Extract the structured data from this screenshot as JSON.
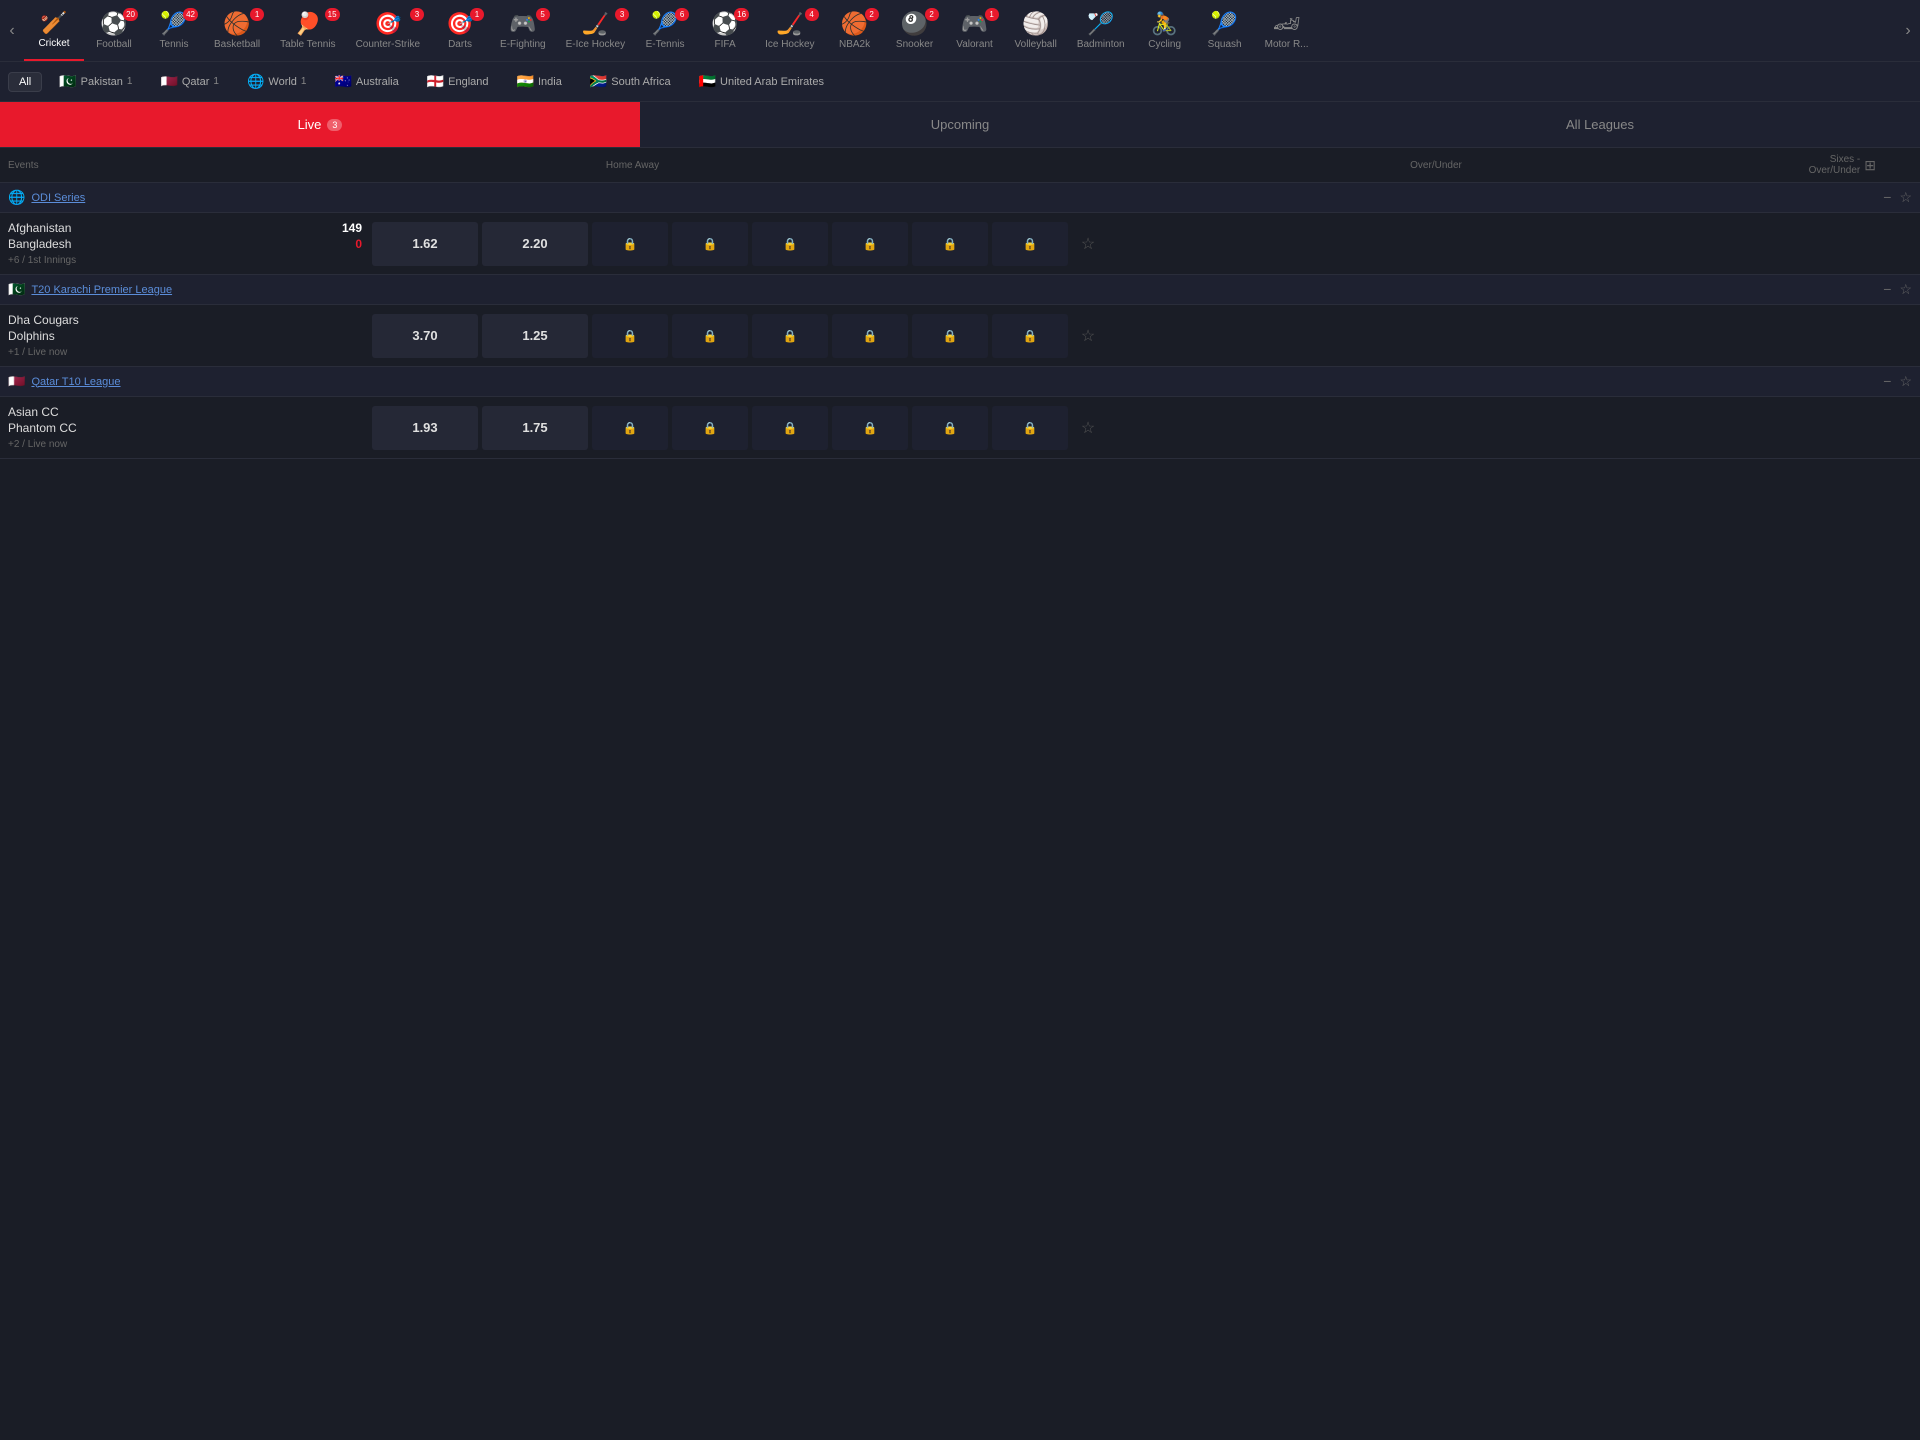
{
  "sports": [
    {
      "id": "cricket",
      "label": "Cricket",
      "icon": "🏏",
      "count": null,
      "active": true
    },
    {
      "id": "football",
      "label": "Football",
      "icon": "⚽",
      "count": 20,
      "active": false
    },
    {
      "id": "tennis",
      "label": "Tennis",
      "icon": "🎾",
      "count": 42,
      "active": false
    },
    {
      "id": "basketball",
      "label": "Basketball",
      "icon": "🏀",
      "count": 1,
      "active": false
    },
    {
      "id": "table-tennis",
      "label": "Table Tennis",
      "icon": "🏓",
      "count": 15,
      "active": false
    },
    {
      "id": "counter-strike",
      "label": "Counter-Strike",
      "icon": "🎯",
      "count": 3,
      "active": false
    },
    {
      "id": "darts",
      "label": "Darts",
      "icon": "🎯",
      "count": 1,
      "active": false
    },
    {
      "id": "e-fighting",
      "label": "E-Fighting",
      "icon": "🎮",
      "count": 5,
      "active": false
    },
    {
      "id": "e-ice-hockey",
      "label": "E-Ice Hockey",
      "icon": "🏒",
      "count": 3,
      "active": false
    },
    {
      "id": "e-tennis",
      "label": "E-Tennis",
      "icon": "🎾",
      "count": 6,
      "active": false
    },
    {
      "id": "fifa",
      "label": "FIFA",
      "icon": "⚽",
      "count": 16,
      "active": false
    },
    {
      "id": "ice-hockey",
      "label": "Ice Hockey",
      "icon": "🏒",
      "count": 4,
      "active": false
    },
    {
      "id": "nba2k",
      "label": "NBA2k",
      "icon": "🏀",
      "count": 2,
      "active": false
    },
    {
      "id": "snooker",
      "label": "Snooker",
      "icon": "🎱",
      "count": 2,
      "active": false
    },
    {
      "id": "valorant",
      "label": "Valorant",
      "icon": "🎮",
      "count": 1,
      "active": false
    },
    {
      "id": "volleyball",
      "label": "Volleyball",
      "icon": "🏐",
      "count": null,
      "active": false
    },
    {
      "id": "badminton",
      "label": "Badminton",
      "icon": "🏸",
      "count": null,
      "active": false
    },
    {
      "id": "cycling",
      "label": "Cycling",
      "icon": "🚴",
      "count": null,
      "active": false
    },
    {
      "id": "squash",
      "label": "Squash",
      "icon": "🎾",
      "count": null,
      "active": false
    },
    {
      "id": "motor",
      "label": "Motor R...",
      "icon": "🏎",
      "count": null,
      "active": false
    }
  ],
  "nav": {
    "prev_label": "‹",
    "next_label": "›"
  },
  "countries": [
    {
      "label": "All",
      "flag": null,
      "count": null,
      "active": true
    },
    {
      "label": "Pakistan",
      "flag": "🇵🇰",
      "count": 1,
      "active": false
    },
    {
      "label": "Qatar",
      "flag": "🇶🇦",
      "count": 1,
      "active": false
    },
    {
      "label": "World",
      "flag": "🌐",
      "count": 1,
      "active": false
    },
    {
      "label": "Australia",
      "flag": "🇦🇺",
      "count": null,
      "active": false
    },
    {
      "label": "England",
      "flag": "🏴󠁧󠁢󠁥󠁮󠁧󠁿",
      "count": null,
      "active": false
    },
    {
      "label": "India",
      "flag": "🇮🇳",
      "count": null,
      "active": false
    },
    {
      "label": "South Africa",
      "flag": "🇿🇦",
      "count": null,
      "active": false
    },
    {
      "label": "United Arab Emirates",
      "flag": "🇦🇪",
      "count": null,
      "active": false
    }
  ],
  "tabs": [
    {
      "label": "Live",
      "count": 3,
      "active": true
    },
    {
      "label": "Upcoming",
      "count": null,
      "active": false
    },
    {
      "label": "All Leagues",
      "count": null,
      "active": false
    }
  ],
  "table_headers": {
    "events": "Events",
    "home_away": "Home Away",
    "over_under": "Over/Under",
    "sixes": "Sixes - Over/Under"
  },
  "leagues": [
    {
      "id": "odi-series",
      "name": "ODI Series",
      "flag": "🌐",
      "matches": [
        {
          "team1": "Afghanistan",
          "team2": "Bangladesh",
          "score1": "149",
          "score2": "0",
          "status": "+6 / 1st Innings",
          "odds_home": "1.62",
          "odds_away": "2.20",
          "locked": [
            true,
            true,
            true,
            true,
            true,
            true
          ]
        }
      ]
    },
    {
      "id": "t20-karachi",
      "name": "T20 Karachi Premier League",
      "flag": "🇵🇰",
      "matches": [
        {
          "team1": "Dha Cougars",
          "team2": "Dolphins",
          "score1": null,
          "score2": null,
          "status": "+1 / Live now",
          "odds_home": "3.70",
          "odds_away": "1.25",
          "locked": [
            true,
            true,
            true,
            true,
            true,
            true
          ]
        }
      ]
    },
    {
      "id": "qatar-t10",
      "name": "Qatar T10 League",
      "flag": "🇶🇦",
      "matches": [
        {
          "team1": "Asian CC",
          "team2": "Phantom CC",
          "score1": null,
          "score2": null,
          "status": "+2 / Live now",
          "odds_home": "1.93",
          "odds_away": "1.75",
          "locked": [
            true,
            true,
            true,
            true,
            true,
            true
          ]
        }
      ]
    }
  ]
}
